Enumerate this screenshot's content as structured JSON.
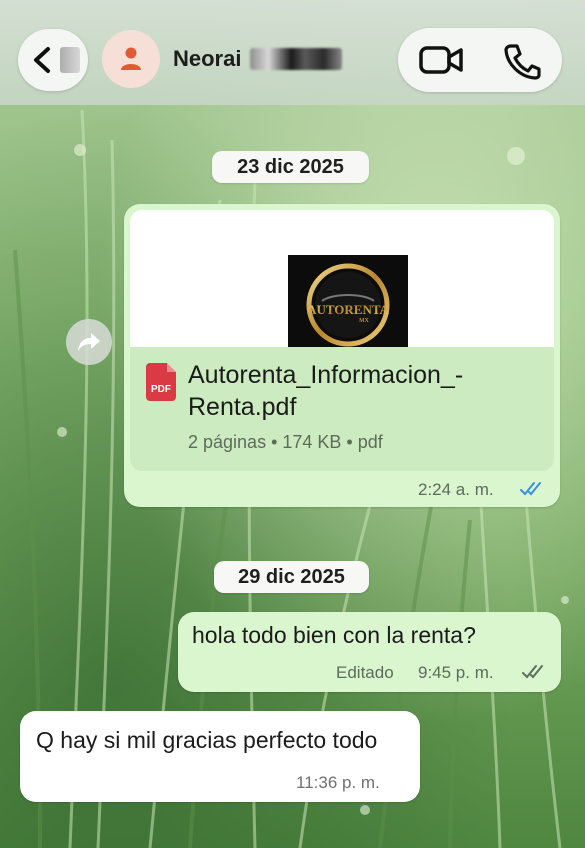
{
  "header": {
    "back_icon": "chevron-left-icon",
    "contact_name": "Neorai",
    "avatar_icon": "person-icon",
    "video_icon": "video-camera-icon",
    "call_icon": "phone-icon"
  },
  "messages": [
    {
      "date": "23 dic 2025",
      "type": "document",
      "direction": "outgoing",
      "preview_logo_text": "AUTORENTA",
      "preview_logo_sub": "MX",
      "file_type_label": "PDF",
      "file_name": "Autorenta_Informacion_-Renta.pdf",
      "file_meta": "2 páginas • 174 KB • pdf",
      "time": "2:24 a. m.",
      "status": "read"
    },
    {
      "date": "29 dic 2025",
      "type": "text",
      "direction": "outgoing",
      "text": "hola todo bien con la renta?",
      "edited_label": "Editado",
      "time": "9:45 p. m.",
      "status": "delivered"
    },
    {
      "type": "text",
      "direction": "incoming",
      "text": "Q hay si mil gracias perfecto todo",
      "time": "11:36 p. m."
    }
  ],
  "colors": {
    "outgoing_bubble": "#d9f6cf",
    "incoming_bubble": "#ffffff",
    "read_ticks": "#3b8ee0",
    "pdf_red": "#d93a43"
  }
}
